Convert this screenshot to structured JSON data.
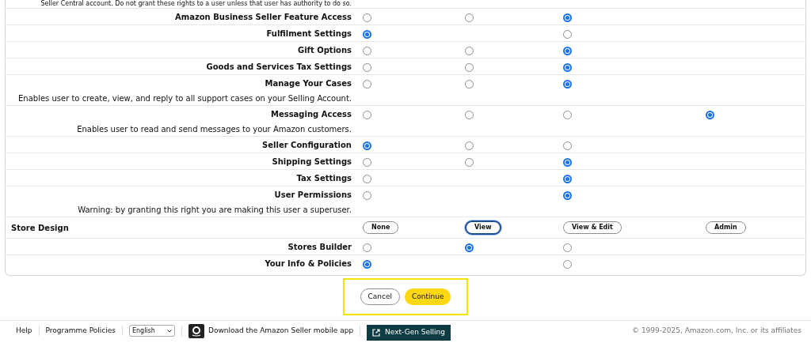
{
  "intro_note": "Seller Central account. Do not grant these rights to a user unless that user has authority to do so.",
  "permissions": [
    {
      "label": "Amazon Business Seller Feature Access",
      "access": {
        "none": {
          "selected": false
        },
        "view": {
          "selected": false
        },
        "view_edit": {
          "selected": true
        }
      }
    },
    {
      "label": "Fulfilment Settings",
      "access": {
        "none": {
          "selected": true
        },
        "view_edit": {
          "selected": false
        }
      }
    },
    {
      "label": "Gift Options",
      "access": {
        "none": {
          "selected": false
        },
        "view": {
          "selected": false
        },
        "view_edit": {
          "selected": true
        }
      }
    },
    {
      "label": "Goods and Services Tax Settings",
      "access": {
        "none": {
          "selected": false
        },
        "view": {
          "selected": false
        },
        "view_edit": {
          "selected": true
        }
      }
    },
    {
      "label": "Manage Your Cases",
      "description": "Enables user to create, view, and reply to all support cases on your Selling Account.",
      "access": {
        "none": {
          "selected": false
        },
        "view": {
          "selected": false
        },
        "view_edit": {
          "selected": true
        }
      }
    },
    {
      "label": "Messaging Access",
      "description": "Enables user to read and send messages to your Amazon customers.",
      "access": {
        "none": {
          "selected": false
        },
        "view": {
          "selected": false
        },
        "view_edit": {
          "selected": false
        },
        "admin": {
          "selected": true
        }
      }
    },
    {
      "label": "Seller Configuration",
      "access": {
        "none": {
          "selected": true
        },
        "view": {
          "selected": false
        },
        "view_edit": {
          "selected": false
        }
      }
    },
    {
      "label": "Shipping Settings",
      "access": {
        "none": {
          "selected": false
        },
        "view": {
          "selected": false
        },
        "view_edit": {
          "selected": true
        }
      }
    },
    {
      "label": "Tax Settings",
      "access": {
        "none": {
          "selected": false
        },
        "view_edit": {
          "selected": true
        }
      }
    },
    {
      "label": "User Permissions",
      "description": "Warning: by granting this right you are making this user a superuser.",
      "access": {
        "none": {
          "selected": false
        },
        "view_edit": {
          "selected": true
        }
      }
    }
  ],
  "group": {
    "title": "Store Design",
    "level_buttons": [
      {
        "label": "None",
        "selected": false
      },
      {
        "label": "View",
        "selected": true
      },
      {
        "label": "View & Edit",
        "selected": false
      },
      {
        "label": "Admin",
        "selected": false
      }
    ],
    "permissions": [
      {
        "label": "Stores Builder",
        "access": {
          "none": {
            "selected": false
          },
          "view": {
            "selected": true
          },
          "view_edit": {
            "selected": false
          }
        }
      },
      {
        "label": "Your Info & Policies",
        "access": {
          "none": {
            "selected": true
          },
          "view_edit": {
            "selected": false
          }
        }
      }
    ]
  },
  "actions": {
    "cancel": "Cancel",
    "continue": "Continue"
  },
  "footer": {
    "links": [
      "Help",
      "Programme Policies"
    ],
    "language": "English",
    "app_link": "Download the Amazon Seller mobile app",
    "next_gen": "Next-Gen Selling",
    "copyright": "© 1999-2025, Amazon.com, Inc. or its affiliates"
  }
}
